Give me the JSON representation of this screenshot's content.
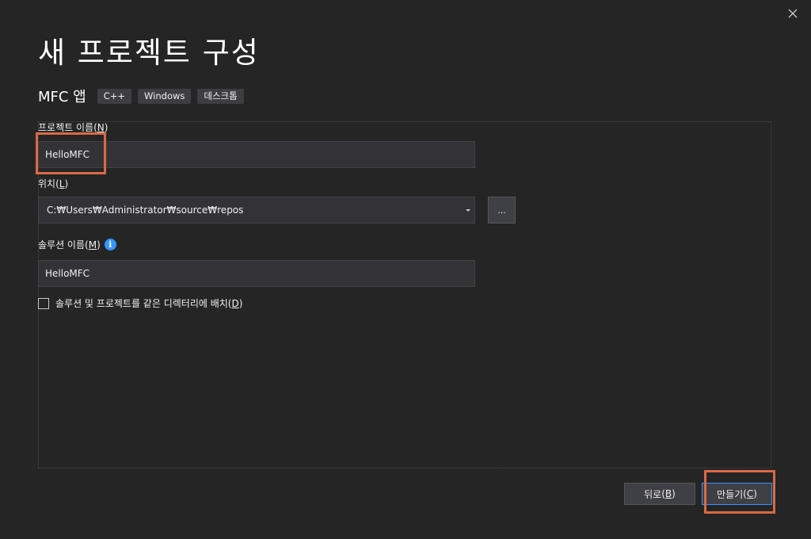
{
  "dialog": {
    "title": "새 프로젝트 구성",
    "template_name": "MFC 앱",
    "tags": [
      "C++",
      "Windows",
      "데스크톱"
    ]
  },
  "form": {
    "project_name": {
      "label": "프로젝트 이름",
      "mnemonic": "N",
      "value": "HelloMFC"
    },
    "location": {
      "label": "위치",
      "mnemonic": "L",
      "value": "C:₩Users₩Administrator₩source₩repos",
      "browse_label": "..."
    },
    "solution_name": {
      "label": "솔루션 이름",
      "mnemonic": "M",
      "value": "HelloMFC",
      "info_glyph": "i"
    },
    "same_directory": {
      "label": "솔루션 및 프로젝트를 같은 디렉터리에 배치",
      "mnemonic": "D",
      "checked": false
    }
  },
  "buttons": {
    "back": {
      "label": "뒤로",
      "mnemonic": "B"
    },
    "create": {
      "label": "만들기",
      "mnemonic": "C"
    }
  },
  "colors": {
    "background": "#252526",
    "input_bg": "#333337",
    "accent": "#3794ff",
    "highlight": "#d96a45"
  },
  "icons": {
    "close": "close-icon",
    "dropdown": "chevron-down-icon",
    "info": "info-icon"
  }
}
